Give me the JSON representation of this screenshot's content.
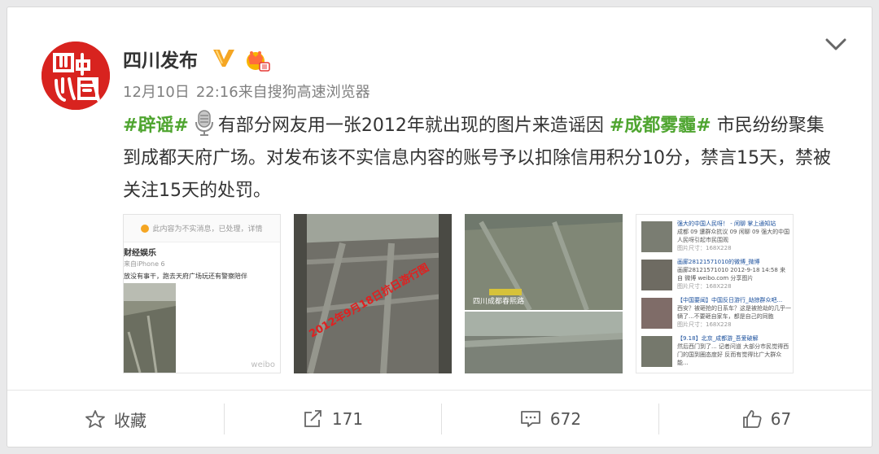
{
  "post": {
    "author": "四川发布",
    "date": "12月10日",
    "time": "22:16",
    "source": "来自搜狗高速浏览器",
    "tag1": "#辟谣#",
    "text1": "有部分网友用一张2012年就出现的图片来造谣因",
    "tag2": "#成都雾霾#",
    "text2": "市民纷纷聚集到成都天府广场。对发布该不实信息内容的账号予以扣除信用积分10分，禁言15天，禁被关注15天的处罚。"
  },
  "avatar_text": "四川中國",
  "images": {
    "img1": {
      "notice": "此内容为不实消息，已处理，详情",
      "user": "财经娱乐",
      "via": "来自iPhone 6",
      "text": "放没有事干，跑去天府广场玩还有警察陪伴",
      "watermark": "weibo"
    },
    "img2": {
      "overlay": "2012年9月18日抗日游行图"
    },
    "img3": {
      "caption": "四川成都春熙路"
    },
    "img4": {
      "items": [
        {
          "title": "强大的中国人民呀！ - 闲聊 掌上通知站",
          "desc": "成都 09 遭群众抗议 09 闲聊 09 强大的中国人民呀引起市民围观",
          "size": "图片尺寸：168X228"
        },
        {
          "title": "画廊28121571010的微博_微博",
          "desc": "画廊28121571010 2012-9-18 14:58 来自 微博 weibo.com 分享图片",
          "size": "图片尺寸：168X228"
        },
        {
          "title": "【中国要闻】中国反日游行_劫掠群众吧...",
          "desc": "西安？被砸抢的日系车？这是被抢劫的几乎一辆了...不要砸自家车，都是自己的同胞",
          "size": "图片尺寸：168X228"
        },
        {
          "title": "【9.18】北京_成都游_吾爱破解",
          "desc": "然后西门到了... 记者问道 大部分市民觉得西门的国到圈态度好 反而有觉得比广大群众能...",
          "size": "图片尺寸：168X228"
        }
      ]
    }
  },
  "footer": {
    "favorite": "收藏",
    "forward": "171",
    "comment": "672",
    "like": "67"
  },
  "colors": {
    "tag": "#4fa530",
    "avatar": "#d8231f",
    "v_badge": "#f5a623"
  },
  "icons": [
    "chevron-down-icon",
    "verified-v-icon",
    "vip-crown-icon",
    "microphone-icon",
    "star-icon",
    "forward-icon",
    "comment-icon",
    "like-icon"
  ]
}
